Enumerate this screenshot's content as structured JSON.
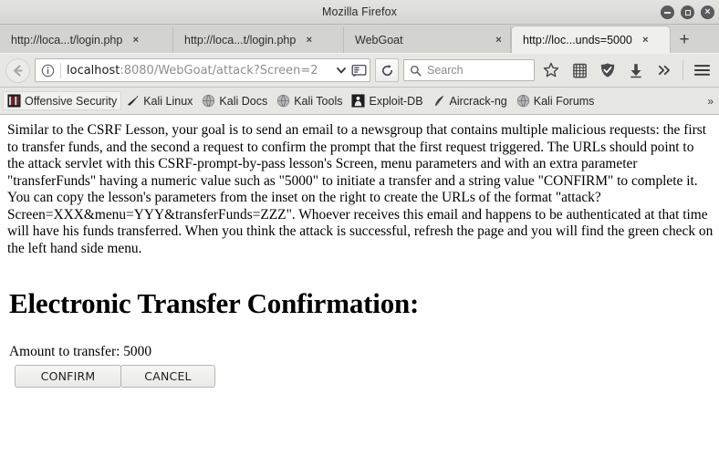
{
  "window": {
    "title": "Mozilla Firefox",
    "controls": {
      "minimize_label": "–",
      "maximize_label": "□",
      "close_label": "×"
    }
  },
  "tabs": {
    "items": [
      {
        "label": "http://loca...t/login.php",
        "close_label": "×",
        "active": false
      },
      {
        "label": "http://loca...t/login.php",
        "close_label": "×",
        "active": false
      },
      {
        "label": "WebGoat",
        "close_label": "×",
        "active": false
      },
      {
        "label": "http://loc...unds=5000",
        "close_label": "×",
        "active": true
      }
    ],
    "new_tab_label": "+"
  },
  "navbar": {
    "back_label": "←",
    "url_domain": "localhost",
    "url_rest": ":8080/WebGoat/attack?Screen=2",
    "url_full_visible": "localhost:8080/WebGoat/attack?Screen=2",
    "identity_icon": "info-icon",
    "dropdown_icon": "chevron-down-icon",
    "reader_icon": "reader-mode-icon",
    "reload_icon": "reload-icon",
    "search_placeholder": "Search",
    "search_value": "",
    "icons": [
      "bookmark-star-icon",
      "library-icon",
      "shield-icon",
      "downloads-icon",
      "overflow-chevrons-icon",
      "hamburger-menu-icon"
    ],
    "overflow_label": "»"
  },
  "bookmarks": {
    "items": [
      {
        "label": "Offensive Security",
        "icon": "offensive-security-icon",
        "highlighted": true
      },
      {
        "label": "Kali Linux",
        "icon": "kali-dragon-icon",
        "highlighted": false
      },
      {
        "label": "Kali Docs",
        "icon": "globe-icon",
        "highlighted": false
      },
      {
        "label": "Kali Tools",
        "icon": "globe-icon",
        "highlighted": false
      },
      {
        "label": "Exploit-DB",
        "icon": "exploit-db-icon",
        "highlighted": false
      },
      {
        "label": "Aircrack-ng",
        "icon": "aircrack-icon",
        "highlighted": false
      },
      {
        "label": "Kali Forums",
        "icon": "globe-icon",
        "highlighted": false
      }
    ],
    "overflow_label": "»"
  },
  "page": {
    "lesson_paragraph": "Similar to the CSRF Lesson, your goal is to send an email to a newsgroup that contains multiple malicious requests: the first to transfer funds, and the second a request to confirm the prompt that the first request triggered. The URLs should point to the attack servlet with this CSRF-prompt-by-pass lesson's Screen, menu parameters and with an extra parameter \"transferFunds\" having a numeric value such as \"5000\" to initiate a transfer and a string value \"CONFIRM\" to complete it. You can copy the lesson's parameters from the inset on the right to create the URLs of the format \"attack?Screen=XXX&menu=YYY&transferFunds=ZZZ\". Whoever receives this email and happens to be authenticated at that time will have his funds transferred. When you think the attack is successful, refresh the page and you will find the green check on the left hand side menu.",
    "heading": "Electronic Transfer Confirmation:",
    "amount_label": "Amount to transfer: 5000",
    "amount_value": "5000",
    "confirm_button": "CONFIRM",
    "cancel_button": "CANCEL"
  },
  "colors": {
    "chrome_bg": "#e6e6e3",
    "titlebar_bg": "#dcdcd9",
    "active_tab_bg": "#efefee",
    "page_bg": "#ffffff",
    "text": "#000000",
    "url_muted": "#8e8e8e"
  }
}
